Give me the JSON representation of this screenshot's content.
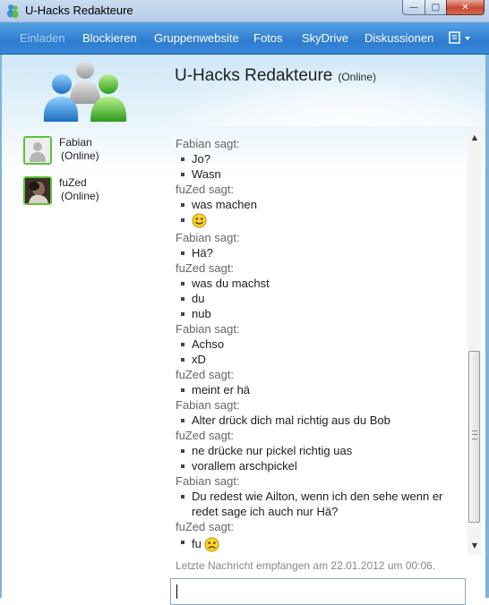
{
  "window": {
    "title": "U-Hacks Redakteure",
    "minimize_glyph": "—",
    "maximize_glyph": "□",
    "close_glyph": "✕"
  },
  "menu": {
    "items": [
      {
        "label": "Einladen",
        "disabled": true
      },
      {
        "label": "Blockieren"
      },
      {
        "label": "Gruppenwebsite"
      },
      {
        "label": "Fotos"
      },
      {
        "label": "SkyDrive"
      },
      {
        "label": "Diskussionen"
      }
    ],
    "extra_icon": "share-menu-icon"
  },
  "group": {
    "name": "U-Hacks Redakteure",
    "status": "(Online)"
  },
  "members": [
    {
      "name": "Fabian",
      "status": "(Online)",
      "icon": "default-avatar-icon"
    },
    {
      "name": "fuZed",
      "status": "(Online)",
      "icon": "photo-avatar-icon"
    }
  ],
  "chat": {
    "blocks": [
      {
        "sender": "Fabian sagt:",
        "messages": [
          "Jo?",
          "Wasn"
        ]
      },
      {
        "sender": "fuZed sagt:",
        "messages": [
          "was machen",
          ":smile:"
        ]
      },
      {
        "sender": "Fabian sagt:",
        "messages": [
          "Hä?"
        ]
      },
      {
        "sender": "fuZed sagt:",
        "messages": [
          "was du machst",
          "du",
          "nub"
        ]
      },
      {
        "sender": "Fabian sagt:",
        "messages": [
          "Achso",
          "xD"
        ]
      },
      {
        "sender": "fuZed sagt:",
        "messages": [
          "meint er hä"
        ]
      },
      {
        "sender": "Fabian sagt:",
        "messages": [
          "Alter drück dich mal richtig aus du Bob"
        ]
      },
      {
        "sender": "fuZed sagt:",
        "messages": [
          "ne drücke nur pickel richtig uas",
          "vorallem arschpickel"
        ]
      },
      {
        "sender": "Fabian sagt:",
        "messages": [
          "Du redest wie Ailton, wenn ich den sehe wenn er redet sage ich auch nur Hä?"
        ]
      },
      {
        "sender": "fuZed sagt:",
        "messages": [
          "fu :sad:"
        ]
      }
    ],
    "last_received": "Letzte Nachricht empfangen am 22.01.2012 um 00:06."
  },
  "scrollbar": {
    "up_glyph": "▲",
    "down_glyph": "▼"
  },
  "colors": {
    "menu_bar": "#2e7cd0",
    "online_green": "#5cc23a",
    "sender_gray": "#666666"
  }
}
